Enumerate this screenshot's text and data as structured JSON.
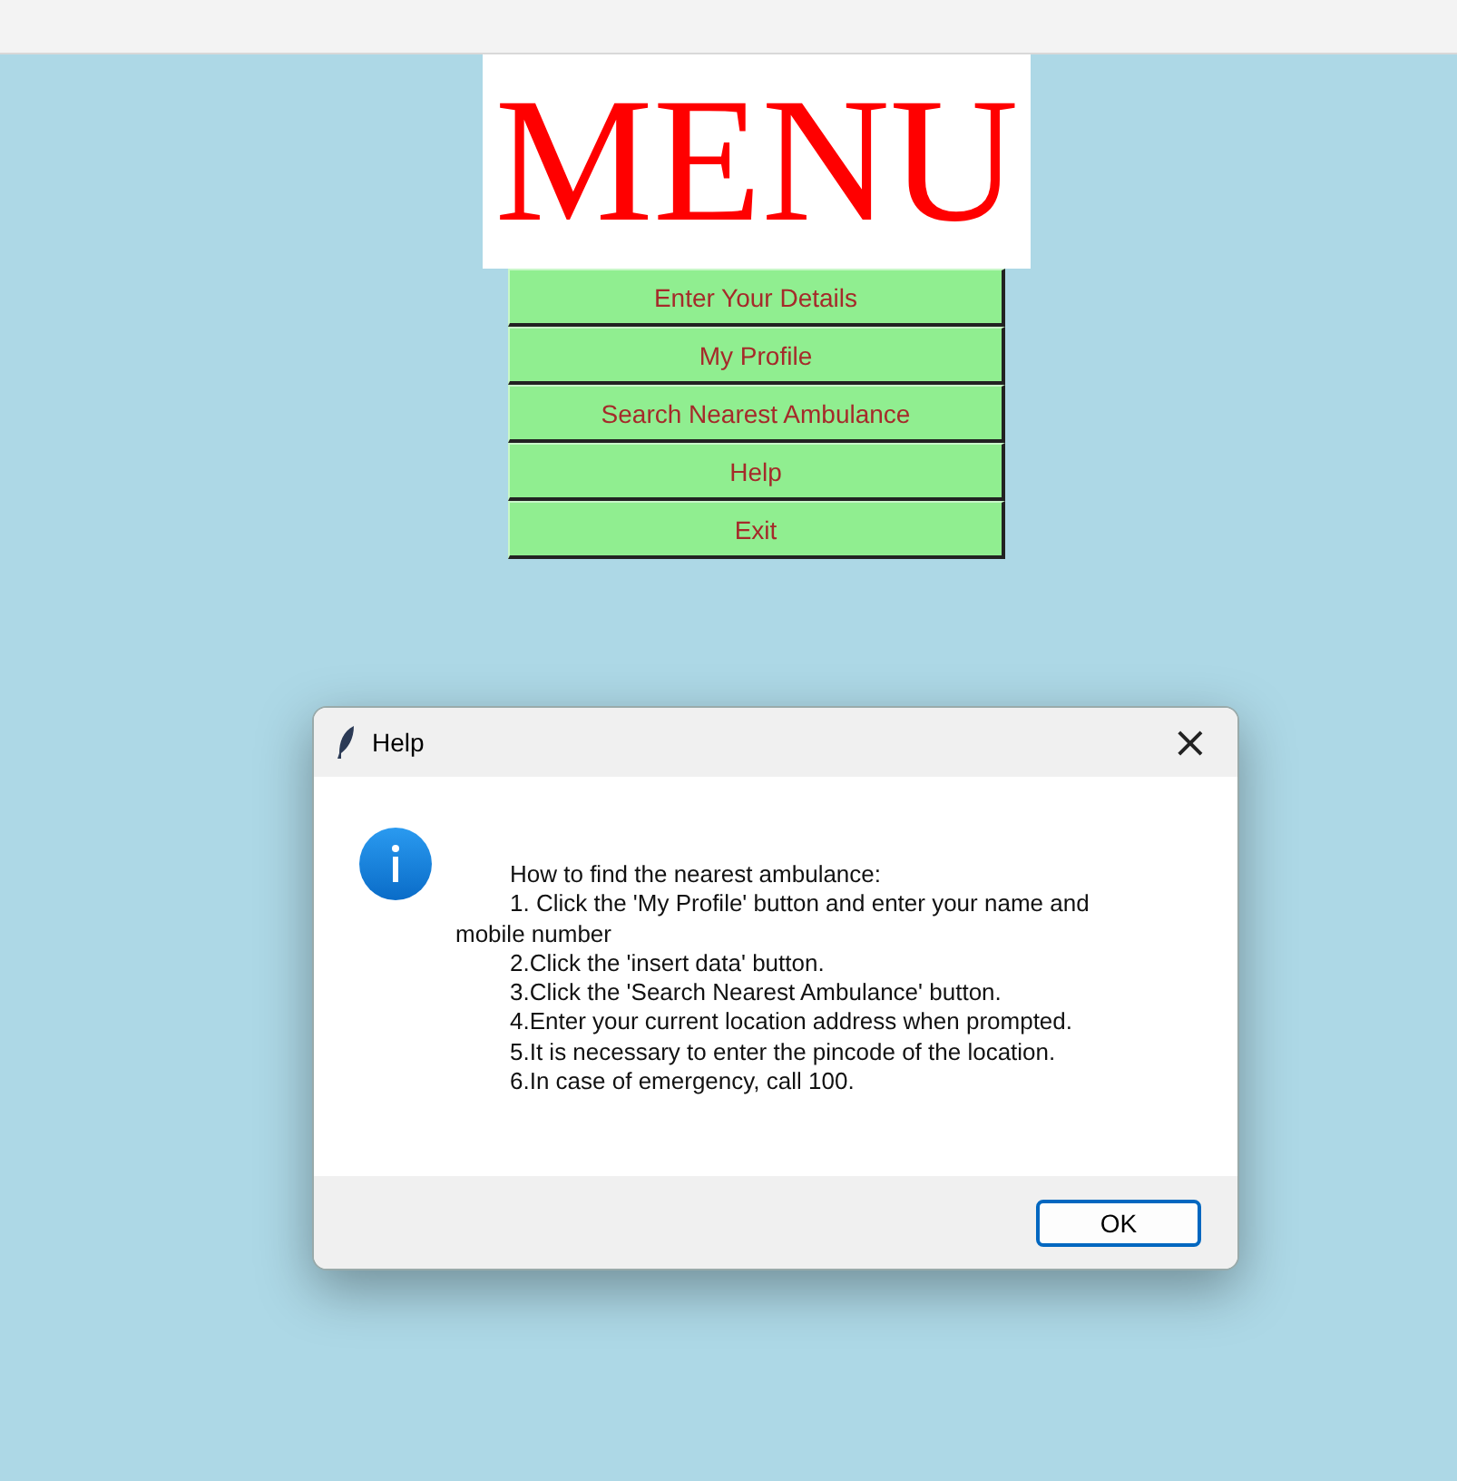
{
  "logo": {
    "text": "MENU"
  },
  "menu_buttons": [
    {
      "label": "Enter Your Details"
    },
    {
      "label": "My Profile"
    },
    {
      "label": "Search Nearest Ambulance"
    },
    {
      "label": "Help"
    },
    {
      "label": "Exit"
    }
  ],
  "dialog": {
    "title": "Help",
    "close": "×",
    "lines": [
      "How to find the nearest ambulance:",
      "1. Click the 'My Profile' button and enter your name and mobile number",
      "2.Click the 'insert data' button.",
      "3.Click the 'Search Nearest Ambulance' button.",
      "4.Enter your current location address when prompted.",
      "5.It is necessary to enter the pincode of the location.",
      "6.In case of emergency, call 100."
    ],
    "ok_button": "OK"
  }
}
